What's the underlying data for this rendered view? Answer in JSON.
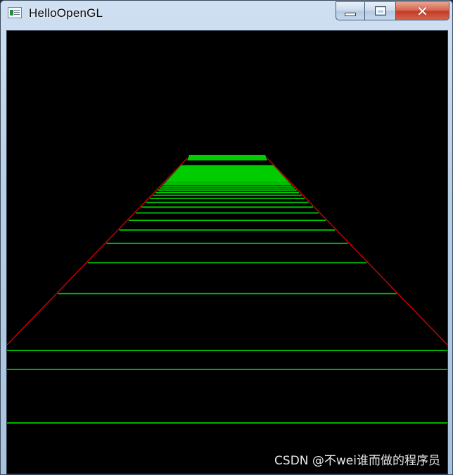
{
  "window": {
    "title": "HelloOpenGL",
    "controls": {
      "minimize_icon": "minimize-icon",
      "maximize_icon": "maximize-icon",
      "close_icon": "close-icon",
      "close_glyph": "✕"
    }
  },
  "scene": {
    "background": "#000000",
    "rail_color": "#d10000",
    "tie_color": "#00cc00",
    "description_icon": "perspective-track"
  },
  "watermark": {
    "text": "CSDN @不wei谁而做的程序员"
  }
}
